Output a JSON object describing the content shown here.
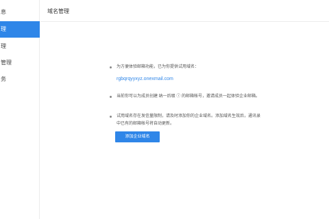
{
  "sidebar": {
    "items": [
      {
        "label": "息",
        "active": false
      },
      {
        "label": "理",
        "active": true
      },
      {
        "label": "理",
        "active": false
      },
      {
        "label": "管理",
        "active": false
      },
      {
        "label": "务",
        "active": false
      }
    ]
  },
  "header": {
    "title": "域名管理"
  },
  "main": {
    "trial_notice": "为方便体验邮箱功能，已为你提供试用域名：",
    "trial_domain": "rgbqrqyyxyz.onexmail.com",
    "member_notice": "当前你可以为成员创建  纳一后缀 ⓘ 的邮箱帐号，邀请成员一起体验企业邮箱。",
    "limit_notice_line1": "试用域名存在发信量限制，请及时添加你的企业域名。添加域名生效后，通讯录",
    "limit_notice_line2": "中已有的邮箱帐号将自动更新。",
    "add_button_label": "添加企业域名"
  },
  "colors": {
    "accent": "#2f86e8"
  }
}
